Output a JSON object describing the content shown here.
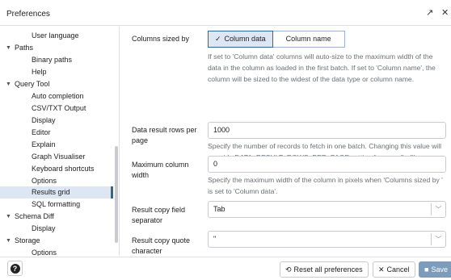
{
  "window": {
    "title": "Preferences",
    "expand_icon": "↗",
    "close_icon": "✕"
  },
  "sidebar": {
    "items": [
      {
        "label": "User language"
      },
      {
        "label": "Paths"
      },
      {
        "label": "Binary paths"
      },
      {
        "label": "Help"
      },
      {
        "label": "Query Tool"
      },
      {
        "label": "Auto completion"
      },
      {
        "label": "CSV/TXT Output"
      },
      {
        "label": "Display"
      },
      {
        "label": "Editor"
      },
      {
        "label": "Explain"
      },
      {
        "label": "Graph Visualiser"
      },
      {
        "label": "Keyboard shortcuts"
      },
      {
        "label": "Options"
      },
      {
        "label": "Results grid"
      },
      {
        "label": "SQL formatting"
      },
      {
        "label": "Schema Diff"
      },
      {
        "label": "Display"
      },
      {
        "label": "Storage"
      },
      {
        "label": "Options"
      }
    ]
  },
  "form": {
    "columns_sized_by": {
      "label": "Columns sized by",
      "option_data": "Column data",
      "option_name": "Column name",
      "check_icon": "✓",
      "help": "If set to 'Column data' columns will auto-size to the maximum width of the data in the column as loaded in the first batch. If set to 'Column name', the column will be sized to the widest of the data type or column name."
    },
    "data_result_rows": {
      "label": "Data result rows per page",
      "value": "1000",
      "help": "Specify the number of records to fetch in one batch. Changing this value will override DATA_RESULT_ROWS_PER_PAGE setting from config file."
    },
    "max_column_width": {
      "label": "Maximum column width",
      "value": "0",
      "help": "Specify the maximum width of the column in pixels when 'Columns sized by ' is set to 'Column data'."
    },
    "copy_field_separator": {
      "label": "Result copy field separator",
      "value": "Tab"
    },
    "copy_quote_character": {
      "label": "Result copy quote character",
      "value": "\""
    }
  },
  "footer": {
    "help_icon": "?",
    "reset_label": "Reset all preferences",
    "reset_icon": "⟲",
    "cancel_label": "Cancel",
    "cancel_icon": "✕",
    "save_label": "Save",
    "save_icon": "■"
  }
}
